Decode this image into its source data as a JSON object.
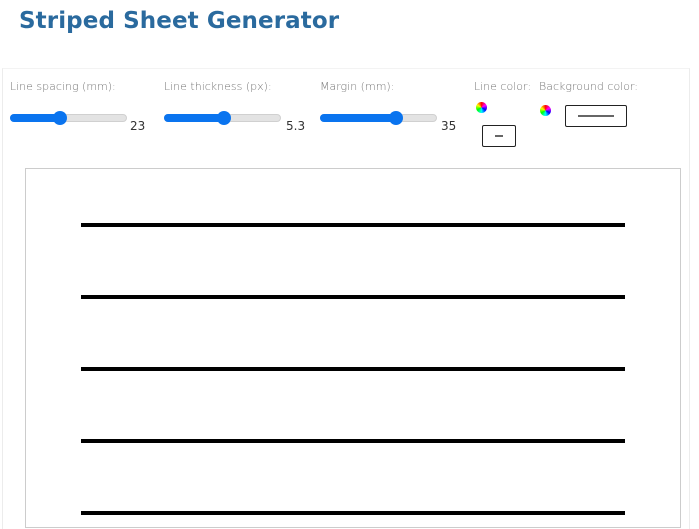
{
  "header": {
    "title": "Striped Sheet Generator",
    "title_color": "#2a6a9e"
  },
  "controls": {
    "line_spacing": {
      "label": "Line spacing (mm):",
      "value": "23",
      "fraction": 0.43
    },
    "line_thickness": {
      "label": "Line thickness (px):",
      "value": "5.3",
      "fraction": 0.51
    },
    "margin": {
      "label": "Margin (mm):",
      "value": "35",
      "fraction": 0.65
    },
    "line_color": {
      "label": "Line color:",
      "icon": "color-wheel-icon",
      "value": "#000000"
    },
    "background_color": {
      "label": "Background color:",
      "icon": "color-wheel-icon",
      "value": "#ffffff"
    },
    "accent_color": "#0a74ef"
  },
  "sheet": {
    "line_color": "#000000",
    "background_color": "#ffffff",
    "visible_line_count": 5
  }
}
